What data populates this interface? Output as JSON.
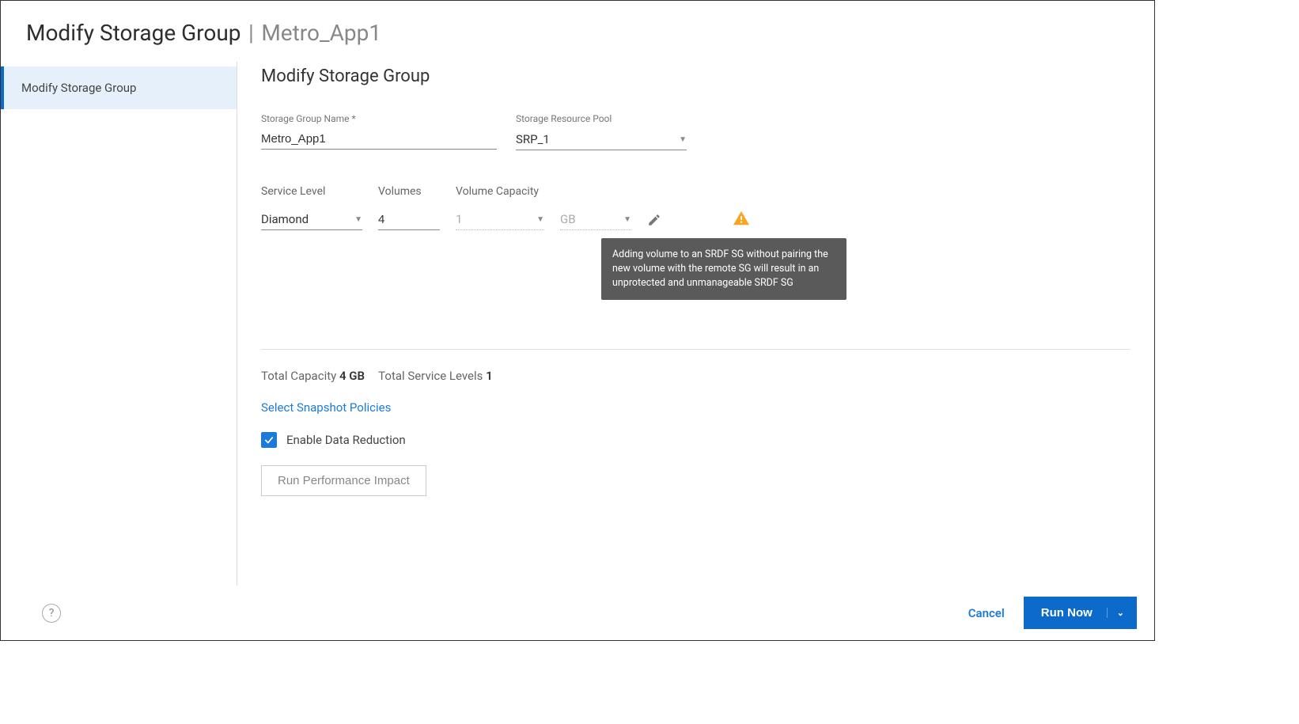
{
  "header": {
    "title": "Modify Storage Group",
    "divider": "|",
    "context": "Metro_App1"
  },
  "sidebar": {
    "items": [
      {
        "label": "Modify Storage Group",
        "active": true
      }
    ]
  },
  "main": {
    "section_title": "Modify Storage Group",
    "fields": {
      "sg_name_label": "Storage Group Name *",
      "sg_name_value": "Metro_App1",
      "srp_label": "Storage Resource Pool",
      "srp_value": "SRP_1"
    },
    "columns": {
      "service_level_label": "Service Level",
      "volumes_label": "Volumes",
      "volume_capacity_label": "Volume Capacity"
    },
    "row": {
      "service_level": "Diamond",
      "volumes": "4",
      "volume_capacity": "1",
      "unit": "GB"
    },
    "tooltip": "Adding volume to an SRDF SG without pairing the new volume with the remote SG will result in an unprotected and unmanageable SRDF SG",
    "totals": {
      "capacity_label": "Total Capacity ",
      "capacity_value": "4 GB",
      "levels_label": "Total Service Levels ",
      "levels_value": "1"
    },
    "snapshot_link": "Select Snapshot Policies",
    "enable_data_reduction_label": "Enable Data Reduction",
    "performance_button": "Run Performance Impact"
  },
  "footer": {
    "help_glyph": "?",
    "cancel": "Cancel",
    "run_now": "Run Now"
  }
}
